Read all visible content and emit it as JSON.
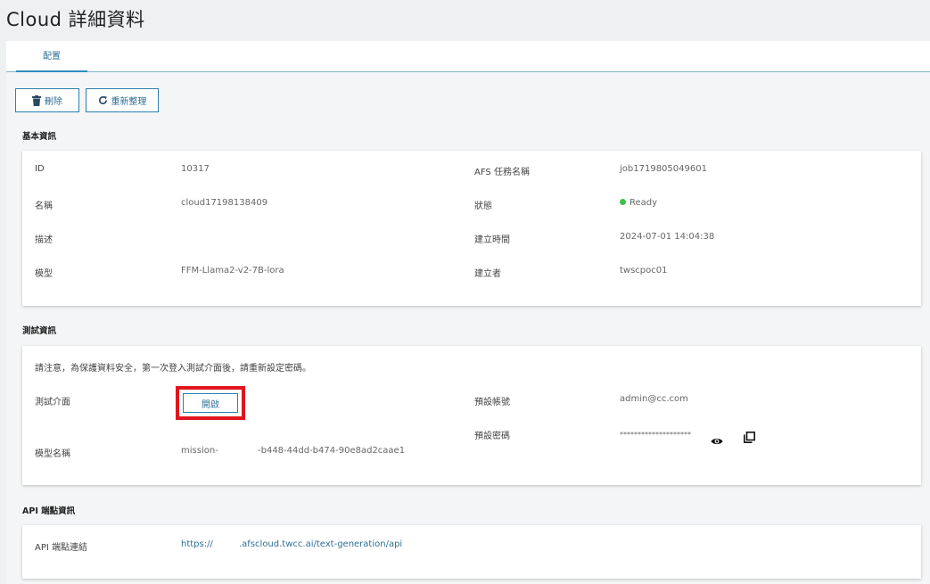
{
  "page": {
    "title": "Cloud 詳細資料"
  },
  "tabs": [
    {
      "label": "配置"
    }
  ],
  "toolbar": {
    "delete_label": "刪除",
    "refresh_label": "重新整理"
  },
  "basic": {
    "title": "基本資訊",
    "fields": {
      "id_label": "ID",
      "id_value": "10317",
      "name_label": "名稱",
      "name_value": "cloud17198138409",
      "desc_label": "描述",
      "desc_value": "",
      "model_label": "模型",
      "model_value": "FFM-Llama2-v2-7B-lora",
      "afs_label": "AFS 任務名稱",
      "afs_value": "job1719805049601",
      "status_label": "狀態",
      "status_value": "Ready",
      "created_label": "建立時間",
      "created_value": "2024-07-01 14:04:38",
      "creator_label": "建立者",
      "creator_value": "twscpoc01"
    }
  },
  "test": {
    "title": "測試資訊",
    "notice": "請注意，為保護資料安全，第一次登入測試介面後，請重新設定密碼。",
    "ui_label": "測試介面",
    "open_label": "開啟",
    "model_name_label": "模型名稱",
    "model_name_prefix": "mission-",
    "model_name_suffix": "-b448-44dd-b474-90e8ad2caae1",
    "account_label": "預設帳號",
    "account_value": "admin@cc.com",
    "password_label": "預設密碼",
    "password_value": "********************"
  },
  "api": {
    "title": "API 端點資訊",
    "link_label": "API 端點連結",
    "link_prefix": "https://",
    "link_suffix": ".afscloud.twcc.ai/text-generation/api"
  },
  "colors": {
    "accent": "#2e7fae",
    "status_ready": "#3ec24a",
    "highlight": "#e0161e"
  },
  "icons": [
    "trash-icon",
    "refresh-icon",
    "eye-icon",
    "copy-icon"
  ]
}
